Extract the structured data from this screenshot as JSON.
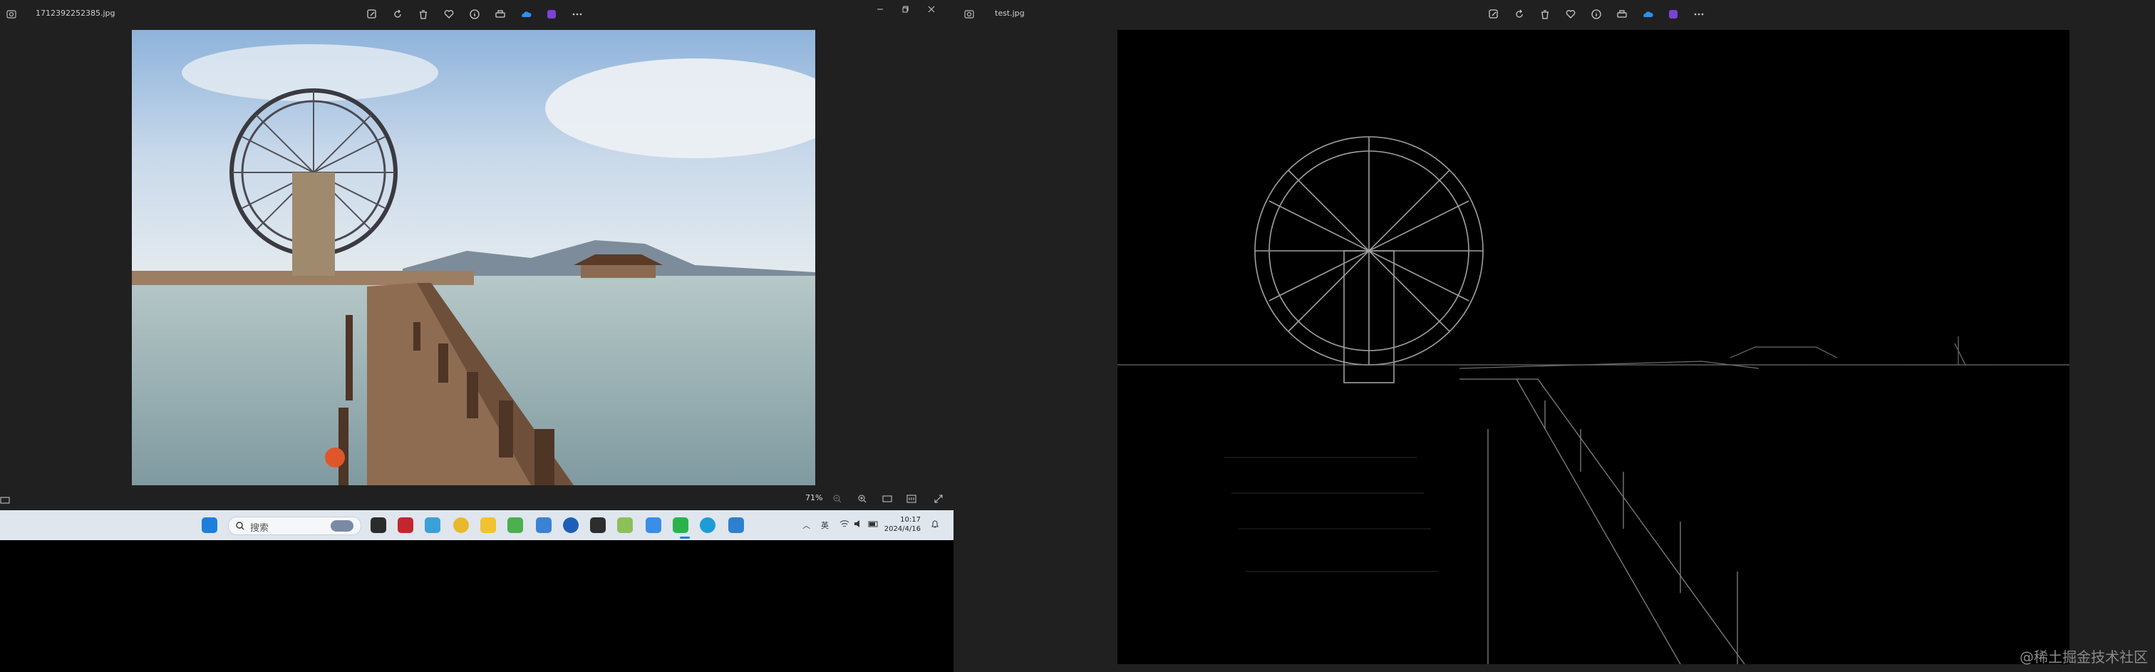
{
  "left_window": {
    "filename": "1712392252385.jpg",
    "zoom": "71%",
    "toolbar": [
      "edit-icon",
      "rotate-icon",
      "delete-icon",
      "favorite-icon",
      "info-icon",
      "print-icon",
      "onedrive-icon",
      "clipchamp-icon",
      "more-icon"
    ],
    "window_controls": [
      "minimize-icon",
      "maximize-icon",
      "close-icon"
    ],
    "image": "photo of waterwheel and wooden boardwalk over lake"
  },
  "right_window": {
    "filename": "test.jpg",
    "toolbar": [
      "edit-icon",
      "rotate-icon",
      "delete-icon",
      "favorite-icon",
      "info-icon",
      "print-icon",
      "onedrive-icon",
      "clipchamp-icon",
      "more-icon"
    ],
    "image": "edge-detected version of waterwheel photo"
  },
  "taskbar": {
    "search_label": "搜索",
    "time": "10:17",
    "date": "2024/4/16",
    "ime": "英"
  },
  "watermark": "@稀土掘金技术社区"
}
